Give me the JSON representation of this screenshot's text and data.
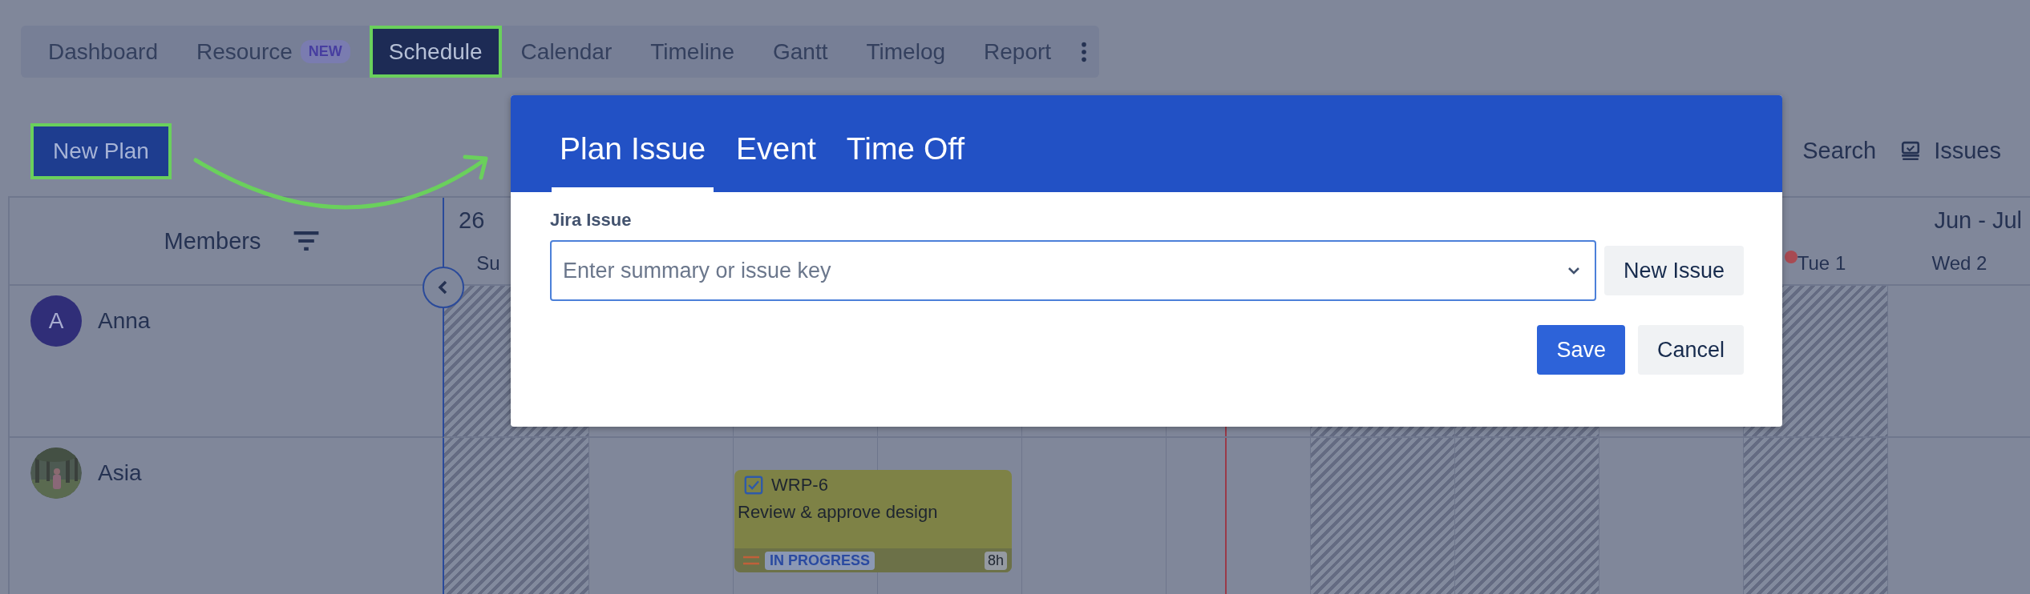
{
  "nav": {
    "tabs": [
      {
        "label": "Dashboard",
        "selected": false,
        "highlighted": false
      },
      {
        "label": "Resource",
        "badge": "NEW",
        "selected": false,
        "highlighted": false
      },
      {
        "label": "Schedule",
        "selected": true,
        "highlighted": true
      },
      {
        "label": "Calendar",
        "selected": false,
        "highlighted": false
      },
      {
        "label": "Timeline",
        "selected": false,
        "highlighted": false
      },
      {
        "label": "Gantt",
        "selected": false,
        "highlighted": false
      },
      {
        "label": "Timelog",
        "selected": false,
        "highlighted": false
      },
      {
        "label": "Report",
        "selected": false,
        "highlighted": false
      }
    ]
  },
  "toolbar": {
    "new_plan": {
      "label": "New Plan",
      "highlighted": true
    },
    "search": "Search",
    "issues": "Issues"
  },
  "calendar": {
    "members_header": "Members",
    "week_label": "26",
    "range_label": "Jun - Jul",
    "days": [
      {
        "label": "Su",
        "non_working": true
      },
      {
        "non_working": false
      },
      {
        "non_working": false
      },
      {
        "non_working": false
      },
      {
        "non_working": false
      },
      {
        "non_working": false,
        "today": true
      },
      {
        "non_working": true
      },
      {
        "non_working": true
      },
      {
        "non_working": false
      },
      {
        "label": "Tue 1",
        "non_working": true,
        "holiday": true
      },
      {
        "label": "Wed 2",
        "non_working": false
      }
    ],
    "members": [
      {
        "name": "Anna",
        "avatar": {
          "kind": "initial",
          "initial": "A"
        }
      },
      {
        "name": "Asia",
        "avatar": {
          "kind": "picture"
        },
        "plans": [
          {
            "key": "WRP-6",
            "summary": "Review & approve design",
            "status": "IN PROGRESS",
            "hours": "8h",
            "done": true
          }
        ]
      }
    ]
  },
  "modal": {
    "tabs": [
      {
        "label": "Plan Issue",
        "selected": true
      },
      {
        "label": "Event",
        "selected": false
      },
      {
        "label": "Time Off",
        "selected": false
      }
    ],
    "field_label": "Jira Issue",
    "placeholder": "Enter summary or issue key",
    "new_issue": "New Issue",
    "buttons": [
      {
        "label": "Save",
        "kind": "primary"
      },
      {
        "label": "Cancel",
        "kind": "secondary"
      }
    ]
  }
}
